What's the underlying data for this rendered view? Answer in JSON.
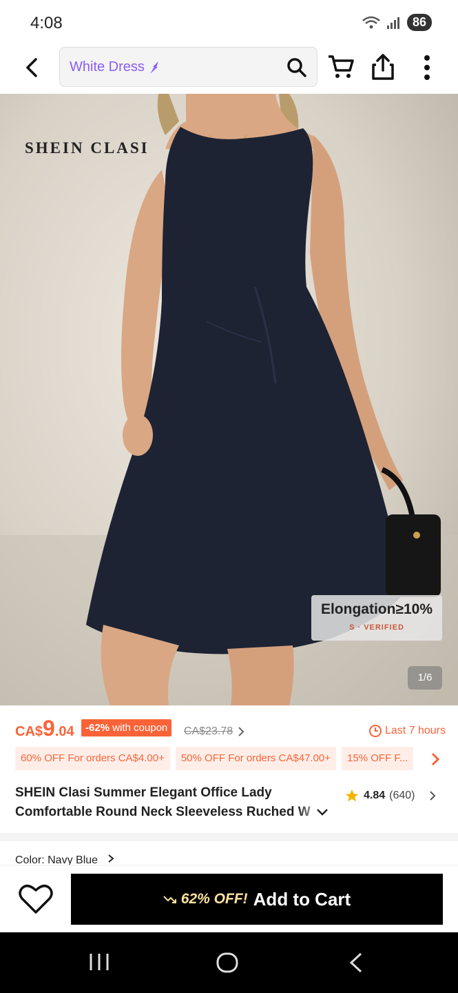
{
  "status_bar": {
    "time": "4:08",
    "battery": "86"
  },
  "header": {
    "search_text": "White Dress"
  },
  "product": {
    "brand_logo": "SHEIN CLASI",
    "elongation_badge": "Elongation≥10%",
    "elongation_sub": "S · VERIFIED",
    "image_counter": "1/6"
  },
  "price": {
    "currency": "CA$",
    "integer": "9",
    "decimal": ".04",
    "discount_pct": "-62%",
    "discount_suffix": "with coupon",
    "original": "CA$23.78",
    "timer": "Last 7 hours"
  },
  "coupons": [
    "60% OFF For orders CA$4.00+",
    "50% OFF For orders CA$47.00+",
    "15% OFF F..."
  ],
  "title": {
    "line1": "SHEIN Clasi Summer  Elegant Office Lady",
    "line2": "Comfortable Round Neck Sleeveless Ruched W"
  },
  "rating": {
    "value": "4.84",
    "count": "(640)"
  },
  "color_row": "Color: Navy Blue",
  "action_bar": {
    "off_text": "62% OFF!",
    "cart_label": "Add to Cart"
  },
  "colors": {
    "accent": "#fa6338",
    "search_purple": "#8a5cf5",
    "dress": "#1d2333"
  }
}
